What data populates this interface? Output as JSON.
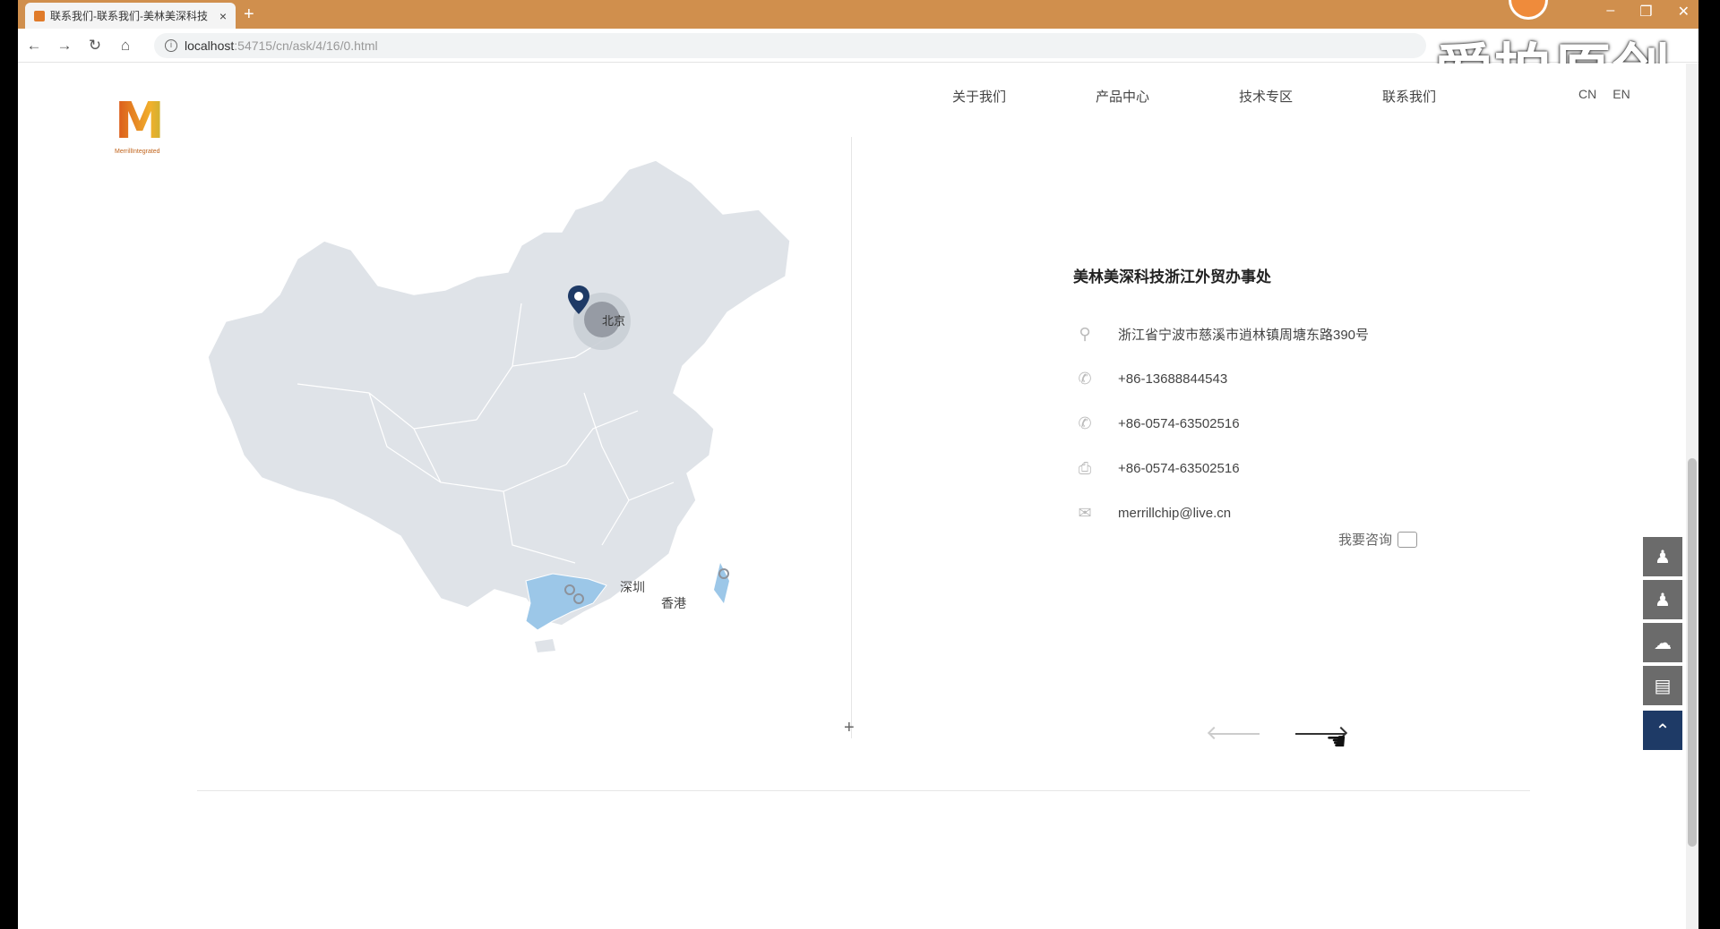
{
  "browser": {
    "tab_title": "联系我们-联系我们-美林美深科技",
    "tab_close": "×",
    "new_tab": "+",
    "url_host": "localhost",
    "url_path": ":54715/cn/ask/4/16/0.html",
    "back": "←",
    "forward": "→",
    "reload": "↻",
    "home": "⌂",
    "win_min": "–",
    "win_max": "❐",
    "win_close": "✕"
  },
  "watermark": "爱拍原创",
  "site": {
    "logo_letter": "M",
    "logo_sub": "MerrillIntegrated",
    "nav": [
      "关于我们",
      "产品中心",
      "技术专区",
      "联系我们"
    ],
    "lang": [
      "CN",
      "EN"
    ]
  },
  "map": {
    "labels": {
      "beijing": "北京",
      "shenzhen": "深圳",
      "hongkong": "香港"
    }
  },
  "office": {
    "title": "美林美深科技浙江外贸办事处",
    "address": "浙江省宁波市慈溪市逍林镇周塘东路390号",
    "phone1": "+86-13688844543",
    "phone2": "+86-0574-63502516",
    "fax": "+86-0574-63502516",
    "email": "merrillchip@live.cn",
    "consult_label": "我要咨询"
  },
  "icons": {
    "location": "location-icon",
    "phone": "phone-icon",
    "fax": "fax-icon",
    "email": "email-icon"
  },
  "colors": {
    "accent": "#1e3a66",
    "map_fill": "#dfe3e8",
    "map_highlight": "#9cc7e8",
    "titlebar": "#d08f4d"
  }
}
